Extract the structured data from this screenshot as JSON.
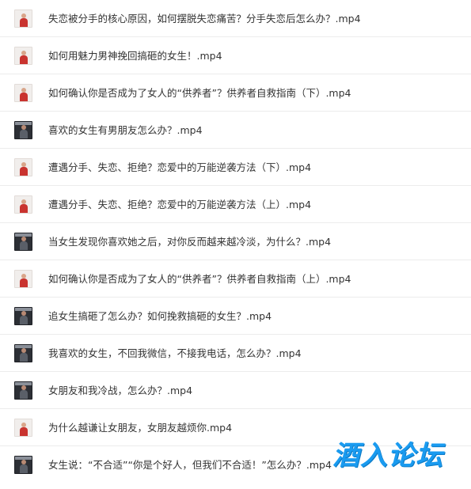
{
  "files": [
    {
      "name": "失恋被分手的核心原因，如何摆脱失恋痛苦？分手失恋后怎么办？.mp4",
      "thumb": "light"
    },
    {
      "name": "如何用魅力男神挽回搞砸的女生！.mp4",
      "thumb": "light"
    },
    {
      "name": "如何确认你是否成为了女人的“供养者”？供养者自救指南（下）.mp4",
      "thumb": "light"
    },
    {
      "name": "喜欢的女生有男朋友怎么办？.mp4",
      "thumb": "dark"
    },
    {
      "name": "遭遇分手、失恋、拒绝？恋爱中的万能逆袭方法（下）.mp4",
      "thumb": "light"
    },
    {
      "name": "遭遇分手、失恋、拒绝？恋爱中的万能逆袭方法（上）.mp4",
      "thumb": "light"
    },
    {
      "name": "当女生发现你喜欢她之后，对你反而越来越冷淡，为什么？.mp4",
      "thumb": "dark"
    },
    {
      "name": "如何确认你是否成为了女人的“供养者”？供养者自救指南（上）.mp4",
      "thumb": "light"
    },
    {
      "name": "追女生搞砸了怎么办？如何挽救搞砸的女生？.mp4",
      "thumb": "dark"
    },
    {
      "name": "我喜欢的女生，不回我微信，不接我电话，怎么办？.mp4",
      "thumb": "dark"
    },
    {
      "name": "女朋友和我冷战，怎么办？.mp4",
      "thumb": "dark"
    },
    {
      "name": "为什么越谦让女朋友，女朋友越烦你.mp4",
      "thumb": "light"
    },
    {
      "name": "女生说：“不合适”“你是个好人，但我们不合适！”怎么办？.mp4",
      "thumb": "dark"
    }
  ],
  "watermark": {
    "text": "酒入论坛"
  },
  "colors": {
    "text": "#333333",
    "divider": "#ececec",
    "watermark": "#1a9bf0"
  }
}
